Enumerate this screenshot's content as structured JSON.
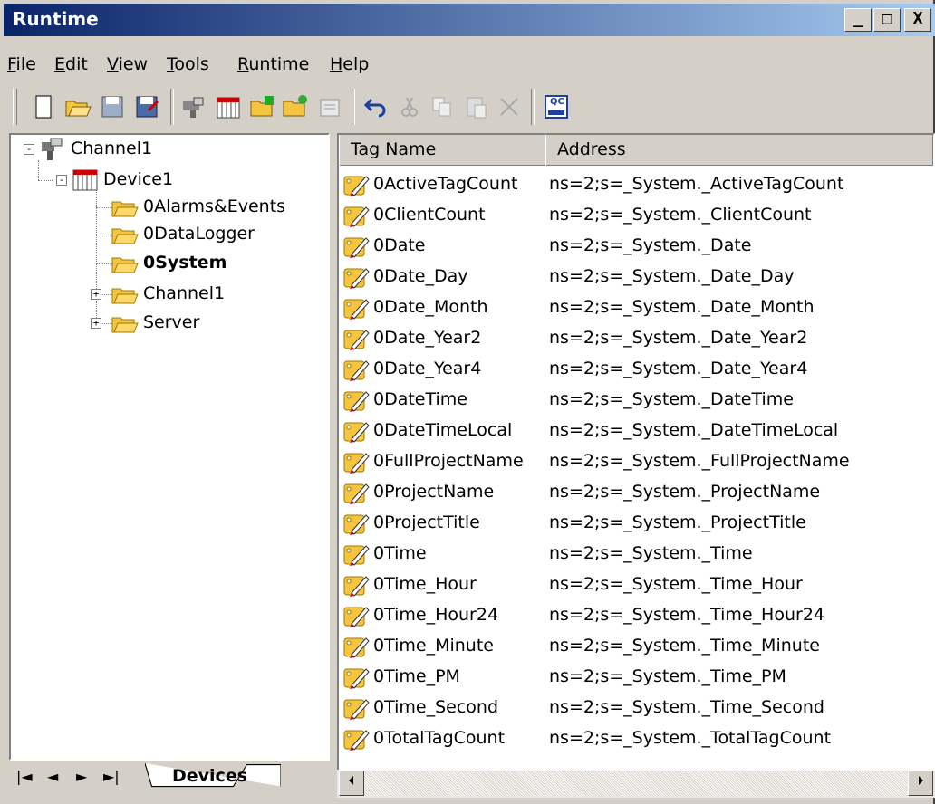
{
  "window": {
    "title": "Runtime"
  },
  "titlebar_buttons": {
    "minimize": "_",
    "maximize": "□",
    "close": "X"
  },
  "menu": [
    {
      "label": "File",
      "accel": "F"
    },
    {
      "label": "Edit",
      "accel": "E"
    },
    {
      "label": "View",
      "accel": "V"
    },
    {
      "label": "Tools",
      "accel": "T"
    },
    {
      "label": "Runtime",
      "accel": "R"
    },
    {
      "label": "Help",
      "accel": "H"
    }
  ],
  "toolbar": {
    "icons": [
      "new-icon",
      "open-icon",
      "save-icon",
      "save-as-icon",
      "new-channel-icon",
      "new-device-icon",
      "new-group-icon",
      "new-tag-icon",
      "properties-icon",
      "undo-icon",
      "cut-icon",
      "copy-icon",
      "paste-icon",
      "delete-icon",
      "quick-client-icon"
    ],
    "qc_label": "QC"
  },
  "tree": {
    "root": "Channel1",
    "device": "Device1",
    "children": [
      "0Alarms&Events",
      "0DataLogger",
      "0System",
      "Channel1",
      "Server"
    ]
  },
  "table": {
    "headers": {
      "tag_name": "Tag Name",
      "address": "Address"
    },
    "rows": [
      {
        "name": "0ActiveTagCount",
        "address": "ns=2;s=_System._ActiveTagCount"
      },
      {
        "name": "0ClientCount",
        "address": "ns=2;s=_System._ClientCount"
      },
      {
        "name": "0Date",
        "address": "ns=2;s=_System._Date"
      },
      {
        "name": "0Date_Day",
        "address": "ns=2;s=_System._Date_Day"
      },
      {
        "name": "0Date_Month",
        "address": "ns=2;s=_System._Date_Month"
      },
      {
        "name": "0Date_Year2",
        "address": "ns=2;s=_System._Date_Year2"
      },
      {
        "name": "0Date_Year4",
        "address": "ns=2;s=_System._Date_Year4"
      },
      {
        "name": "0DateTime",
        "address": "ns=2;s=_System._DateTime"
      },
      {
        "name": "0DateTimeLocal",
        "address": "ns=2;s=_System._DateTimeLocal"
      },
      {
        "name": "0FullProjectName",
        "address": "ns=2;s=_System._FullProjectName"
      },
      {
        "name": "0ProjectName",
        "address": "ns=2;s=_System._ProjectName"
      },
      {
        "name": "0ProjectTitle",
        "address": "ns=2;s=_System._ProjectTitle"
      },
      {
        "name": "0Time",
        "address": "ns=2;s=_System._Time"
      },
      {
        "name": "0Time_Hour",
        "address": "ns=2;s=_System._Time_Hour"
      },
      {
        "name": "0Time_Hour24",
        "address": "ns=2;s=_System._Time_Hour24"
      },
      {
        "name": "0Time_Minute",
        "address": "ns=2;s=_System._Time_Minute"
      },
      {
        "name": "0Time_PM",
        "address": "ns=2;s=_System._Time_PM"
      },
      {
        "name": "0Time_Second",
        "address": "ns=2;s=_System._Time_Second"
      },
      {
        "name": "0TotalTagCount",
        "address": "ns=2;s=_System._TotalTagCount"
      }
    ]
  },
  "bottom": {
    "nav": [
      "|◄",
      "◄",
      "►",
      "►|"
    ],
    "tab_label": "Devices"
  },
  "colors": {
    "title_start": "#0a246a",
    "title_end": "#a6caf0",
    "face": "#d4d0c8",
    "folder": "#f5c542"
  }
}
